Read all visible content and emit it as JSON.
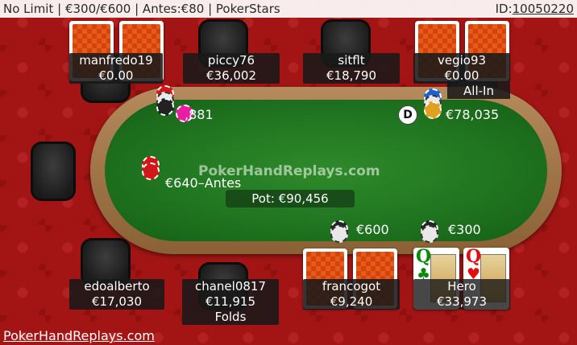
{
  "header": {
    "title": "No Limit | €300/€600 | Antes:€80 | PokerStars",
    "hand_id_label": "ID:",
    "hand_id": "10050220"
  },
  "footer": {
    "link": "PokerHandReplays.com"
  },
  "table": {
    "watermark": "PokerHandReplays.com",
    "pot": "Pot: €90,456",
    "colors": {
      "felt": "#207520",
      "rail": "#a0723f",
      "background": "#a31515"
    }
  },
  "seats": {
    "manfredo19": {
      "name": "manfredo19",
      "stack": "€0.00"
    },
    "piccy76": {
      "name": "piccy76",
      "stack": "€36,002"
    },
    "sitflt": {
      "name": "sitflt",
      "stack": "€18,790"
    },
    "vegio93": {
      "name": "vegio93",
      "stack": "€0.00",
      "action": "All-In"
    },
    "edoalberto": {
      "name": "edoalberto",
      "stack": "€17,030"
    },
    "chanel0817": {
      "name": "chanel0817",
      "stack": "€11,915",
      "action": "Folds"
    },
    "francogot": {
      "name": "francogot",
      "stack": "€9,240"
    },
    "hero": {
      "name": "Hero",
      "stack": "€33,973"
    }
  },
  "bets": {
    "manfredo19": "€",
    "manfredo19_rest": ",881",
    "vegio93": "€78,035",
    "antes": "€640–Antes",
    "francogot": "€600",
    "hero": "€300"
  },
  "hero_cards": [
    {
      "rank": "Q",
      "suit": "♣",
      "color": "#0a8a0a"
    },
    {
      "rank": "Q",
      "suit": "♥",
      "color": "#e01010"
    }
  ],
  "dealer_button": "D"
}
